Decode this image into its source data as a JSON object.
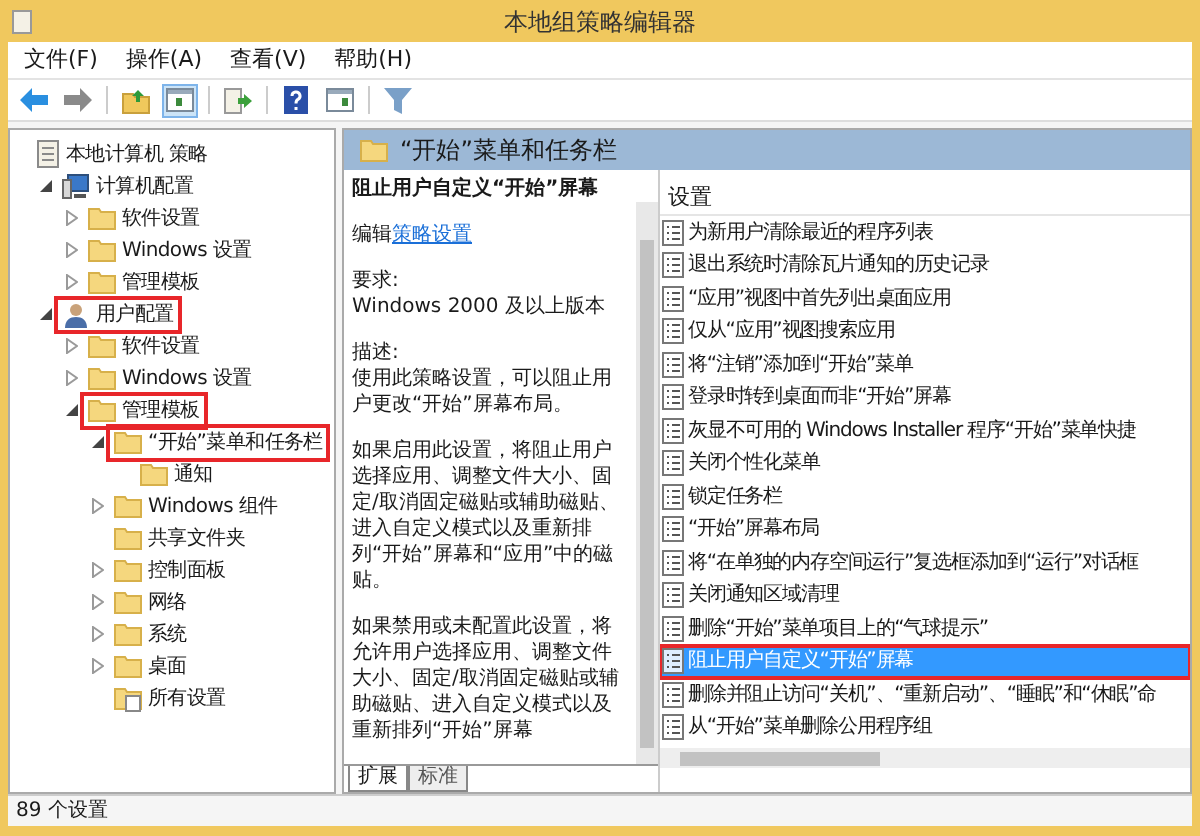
{
  "window": {
    "title": "本地组策略编辑器"
  },
  "menu": [
    "文件(F)",
    "操作(A)",
    "查看(V)",
    "帮助(H)"
  ],
  "toolbar": [
    [
      {
        "kind": "back",
        "pressed": false
      },
      {
        "kind": "forward",
        "pressed": false
      }
    ],
    [
      {
        "kind": "up",
        "pressed": false
      },
      {
        "kind": "tree",
        "pressed": true
      }
    ],
    [
      {
        "kind": "export",
        "pressed": false
      }
    ],
    [
      {
        "kind": "help",
        "pressed": false
      },
      {
        "kind": "pane",
        "pressed": false
      }
    ],
    [
      {
        "kind": "filter",
        "pressed": false
      }
    ]
  ],
  "tree": [
    {
      "label": "本地计算机 策略",
      "kind": "policy",
      "highlighted": false,
      "children": [
        {
          "label": "计算机配置",
          "kind": "computer",
          "expanded": true,
          "highlighted": false,
          "children": [
            {
              "label": "软件设置",
              "kind": "folder",
              "expanded": false,
              "highlighted": false
            },
            {
              "label": "Windows 设置",
              "kind": "folder",
              "expanded": false,
              "highlighted": false
            },
            {
              "label": "管理模板",
              "kind": "folder",
              "expanded": false,
              "highlighted": false
            }
          ]
        },
        {
          "label": "用户配置",
          "kind": "user",
          "expanded": true,
          "highlighted": true,
          "children": [
            {
              "label": "软件设置",
              "kind": "folder",
              "expanded": false,
              "highlighted": false
            },
            {
              "label": "Windows 设置",
              "kind": "folder",
              "expanded": false,
              "highlighted": false
            },
            {
              "label": "管理模板",
              "kind": "folder",
              "expanded": true,
              "highlighted": true,
              "children": [
                {
                  "label": "“开始”菜单和任务栏",
                  "kind": "folder",
                  "expanded": true,
                  "highlighted": true,
                  "children": [
                    {
                      "label": "通知",
                      "kind": "folder",
                      "highlighted": false
                    }
                  ]
                },
                {
                  "label": "Windows 组件",
                  "kind": "folder",
                  "expanded": false,
                  "highlighted": false
                },
                {
                  "label": "共享文件夹",
                  "kind": "folder",
                  "highlighted": false
                },
                {
                  "label": "控制面板",
                  "kind": "folder",
                  "expanded": false,
                  "highlighted": false
                },
                {
                  "label": "网络",
                  "kind": "folder",
                  "expanded": false,
                  "highlighted": false
                },
                {
                  "label": "系统",
                  "kind": "folder",
                  "expanded": false,
                  "highlighted": false
                },
                {
                  "label": "桌面",
                  "kind": "folder",
                  "expanded": false,
                  "highlighted": false
                },
                {
                  "label": "所有设置",
                  "kind": "all",
                  "highlighted": false
                }
              ]
            }
          ]
        }
      ]
    }
  ],
  "details": {
    "header": "“开始”菜单和任务栏",
    "title": "阻止用户自定义“开始”屏幕",
    "edit_prefix": "编辑",
    "edit_link": "策略设置",
    "requirements_label": "要求:",
    "requirements": "Windows 2000 及以上版本",
    "description_label": "描述:",
    "paragraphs": [
      "使用此策略设置，可以阻止用户更改“开始”屏幕布局。",
      "如果启用此设置，将阻止用户选择应用、调整文件大小、固定/取消固定磁贴或辅助磁贴、进入自定义模式以及重新排列“开始”屏幕和“应用”中的磁贴。",
      "如果禁用或未配置此设置，将允许用户选择应用、调整文件大小、固定/取消固定磁贴或辅助磁贴、进入自定义模式以及重新排列“开始”屏幕"
    ]
  },
  "tabs": [
    {
      "label": "扩展",
      "selected": true
    },
    {
      "label": "标准",
      "selected": false
    }
  ],
  "settings": {
    "column": "设置",
    "rows": [
      {
        "label": "为新用户清除最近的程序列表",
        "selected": false,
        "highlighted": false
      },
      {
        "label": "退出系统时清除瓦片通知的历史记录",
        "selected": false,
        "highlighted": false
      },
      {
        "label": "“应用”视图中首先列出桌面应用",
        "selected": false,
        "highlighted": false
      },
      {
        "label": "仅从“应用”视图搜索应用",
        "selected": false,
        "highlighted": false
      },
      {
        "label": "将“注销”添加到“开始”菜单",
        "selected": false,
        "highlighted": false
      },
      {
        "label": "登录时转到桌面而非“开始”屏幕",
        "selected": false,
        "highlighted": false
      },
      {
        "label": "灰显不可用的 Windows Installer 程序“开始”菜单快捷",
        "selected": false,
        "highlighted": false
      },
      {
        "label": "关闭个性化菜单",
        "selected": false,
        "highlighted": false
      },
      {
        "label": "锁定任务栏",
        "selected": false,
        "highlighted": false
      },
      {
        "label": "“开始”屏幕布局",
        "selected": false,
        "highlighted": false
      },
      {
        "label": "将“在单独的内存空间运行”复选框添加到“运行”对话框",
        "selected": false,
        "highlighted": false
      },
      {
        "label": "关闭通知区域清理",
        "selected": false,
        "highlighted": false
      },
      {
        "label": "删除“开始”菜单项目上的“气球提示”",
        "selected": false,
        "highlighted": false
      },
      {
        "label": "阻止用户自定义“开始”屏幕",
        "selected": true,
        "highlighted": true
      },
      {
        "label": "删除并阻止访问“关机”、“重新启动”、“睡眠”和“休眠”命",
        "selected": false,
        "highlighted": false
      },
      {
        "label": "从“开始”菜单删除公用程序组",
        "selected": false,
        "highlighted": false
      }
    ]
  },
  "status_bar": "89 个设置"
}
